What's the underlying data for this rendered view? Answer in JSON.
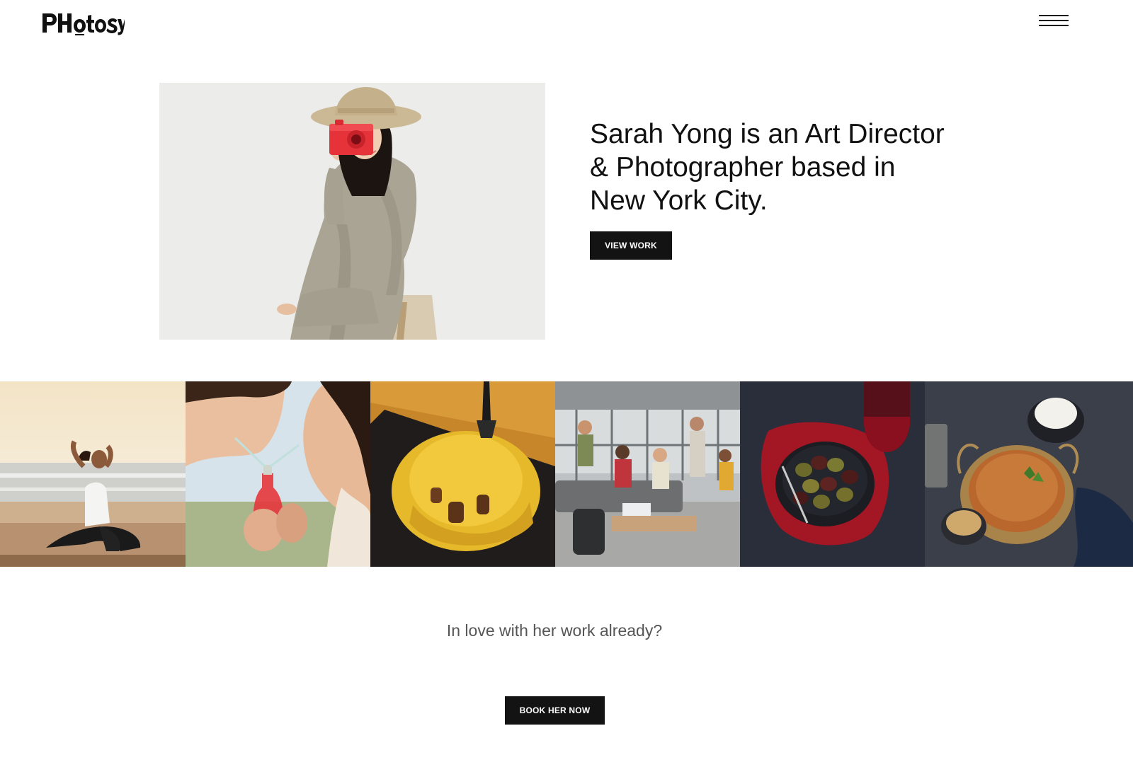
{
  "header": {
    "logo_text": "PHOtoSY",
    "menu_icon": "hamburger-menu-icon"
  },
  "hero": {
    "headline": "Sarah Yong is an Art Director & Photographer based in New York City.",
    "button_label": "VIEW WORK"
  },
  "gallery": {
    "items": [
      {
        "subject": "yoga-on-beach-photo"
      },
      {
        "subject": "couple-sharing-drink-photo"
      },
      {
        "subject": "cheese-burger-photo"
      },
      {
        "subject": "office-team-photo"
      },
      {
        "subject": "olives-and-wine-photo"
      },
      {
        "subject": "curry-dish-photo"
      }
    ]
  },
  "cta": {
    "text": "In love with her work already?",
    "button_label": "BOOK HER NOW"
  },
  "colors": {
    "button_bg": "#131313",
    "button_text": "#ffffff",
    "body_text": "#111111",
    "cta_text": "#555555"
  }
}
